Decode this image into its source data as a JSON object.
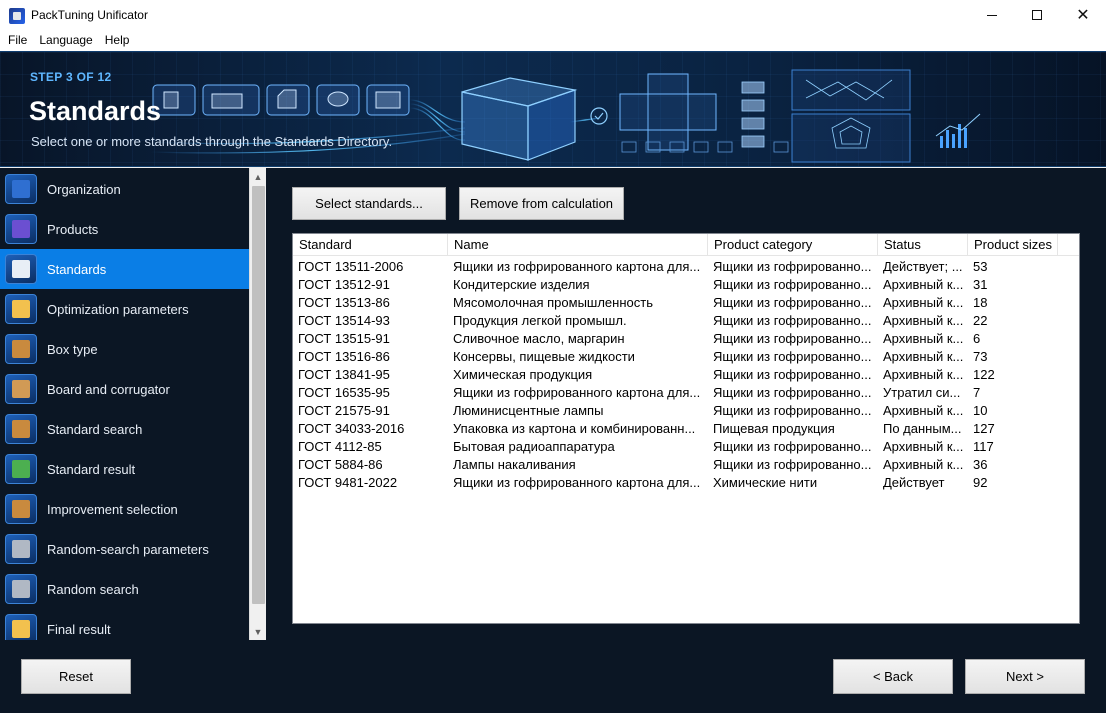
{
  "window": {
    "title": "PackTuning Unificator"
  },
  "menu": [
    "File",
    "Language",
    "Help"
  ],
  "banner": {
    "step": "STEP 3 OF 12",
    "title": "Standards",
    "subtitle": "Select one or more standards through the Standards Directory."
  },
  "sidebar": {
    "items": [
      {
        "label": "Organization",
        "icon": "clipboard-user-icon",
        "color": "#2f6fd1"
      },
      {
        "label": "Products",
        "icon": "bottles-icon",
        "color": "#6b4fd1"
      },
      {
        "label": "Standards",
        "icon": "gost-document-icon",
        "color": "#e8eef6"
      },
      {
        "label": "Optimization parameters",
        "icon": "clipboard-list-icon",
        "color": "#f2c14e"
      },
      {
        "label": "Box type",
        "icon": "boxes-icon",
        "color": "#c98a3e"
      },
      {
        "label": "Board and corrugator",
        "icon": "corrugated-board-icon",
        "color": "#d19a55"
      },
      {
        "label": "Standard search",
        "icon": "box-search-icon",
        "color": "#c98a3e"
      },
      {
        "label": "Standard result",
        "icon": "box-check-icon",
        "color": "#4caf50"
      },
      {
        "label": "Improvement selection",
        "icon": "box-gear-icon",
        "color": "#c98a3e"
      },
      {
        "label": "Random-search parameters",
        "icon": "gears-icon",
        "color": "#b0b8c4"
      },
      {
        "label": "Random search",
        "icon": "dice-search-icon",
        "color": "#b0b8c4"
      },
      {
        "label": "Final result",
        "icon": "trophy-icon",
        "color": "#f2c14e"
      }
    ],
    "active_index": 2
  },
  "toolbar": {
    "select_label": "Select standards...",
    "remove_label": "Remove from calculation"
  },
  "table": {
    "columns": [
      "Standard",
      "Name",
      "Product category",
      "Status",
      "Product sizes"
    ],
    "rows": [
      [
        "ГОСТ 13511-2006",
        "Ящики из гофрированного картона для...",
        "Ящики из гофрированно...",
        "Действует; ...",
        "53"
      ],
      [
        "ГОСТ 13512-91",
        "Кондитерские изделия",
        "Ящики из гофрированно...",
        "Архивный к...",
        "31"
      ],
      [
        "ГОСТ 13513-86",
        "Мясомолочная промышленность",
        "Ящики из гофрированно...",
        "Архивный к...",
        "18"
      ],
      [
        "ГОСТ 13514-93",
        "Продукция легкой промышл.",
        "Ящики из гофрированно...",
        "Архивный к...",
        "22"
      ],
      [
        "ГОСТ 13515-91",
        "Сливочное масло, маргарин",
        "Ящики из гофрированно...",
        "Архивный к...",
        "6"
      ],
      [
        "ГОСТ 13516-86",
        "Консервы, пищевые жидкости",
        "Ящики из гофрированно...",
        "Архивный к...",
        "73"
      ],
      [
        "ГОСТ 13841-95",
        "Химическая продукция",
        "Ящики из гофрированно...",
        "Архивный к...",
        "122"
      ],
      [
        "ГОСТ 16535-95",
        "Ящики из гофрированного картона для...",
        "Ящики из гофрированно...",
        "Утратил си...",
        "7"
      ],
      [
        "ГОСТ 21575-91",
        "Люминисцентные лампы",
        "Ящики из гофрированно...",
        "Архивный к...",
        "10"
      ],
      [
        "ГОСТ 34033-2016",
        "Упаковка из картона и комбинированн...",
        "Пищевая продукция",
        "По данным...",
        "127"
      ],
      [
        "ГОСТ 4112-85",
        "Бытовая радиоаппаратура",
        "Ящики из гофрированно...",
        "Архивный к...",
        "117"
      ],
      [
        "ГОСТ 5884-86",
        "Лампы накаливания",
        "Ящики из гофрированно...",
        "Архивный к...",
        "36"
      ],
      [
        "ГОСТ 9481-2022",
        "Ящики из гофрированного картона для...",
        "Химические нити",
        "Действует",
        "92"
      ]
    ]
  },
  "footer": {
    "reset_label": "Reset",
    "back_label": "< Back",
    "next_label": "Next >"
  }
}
